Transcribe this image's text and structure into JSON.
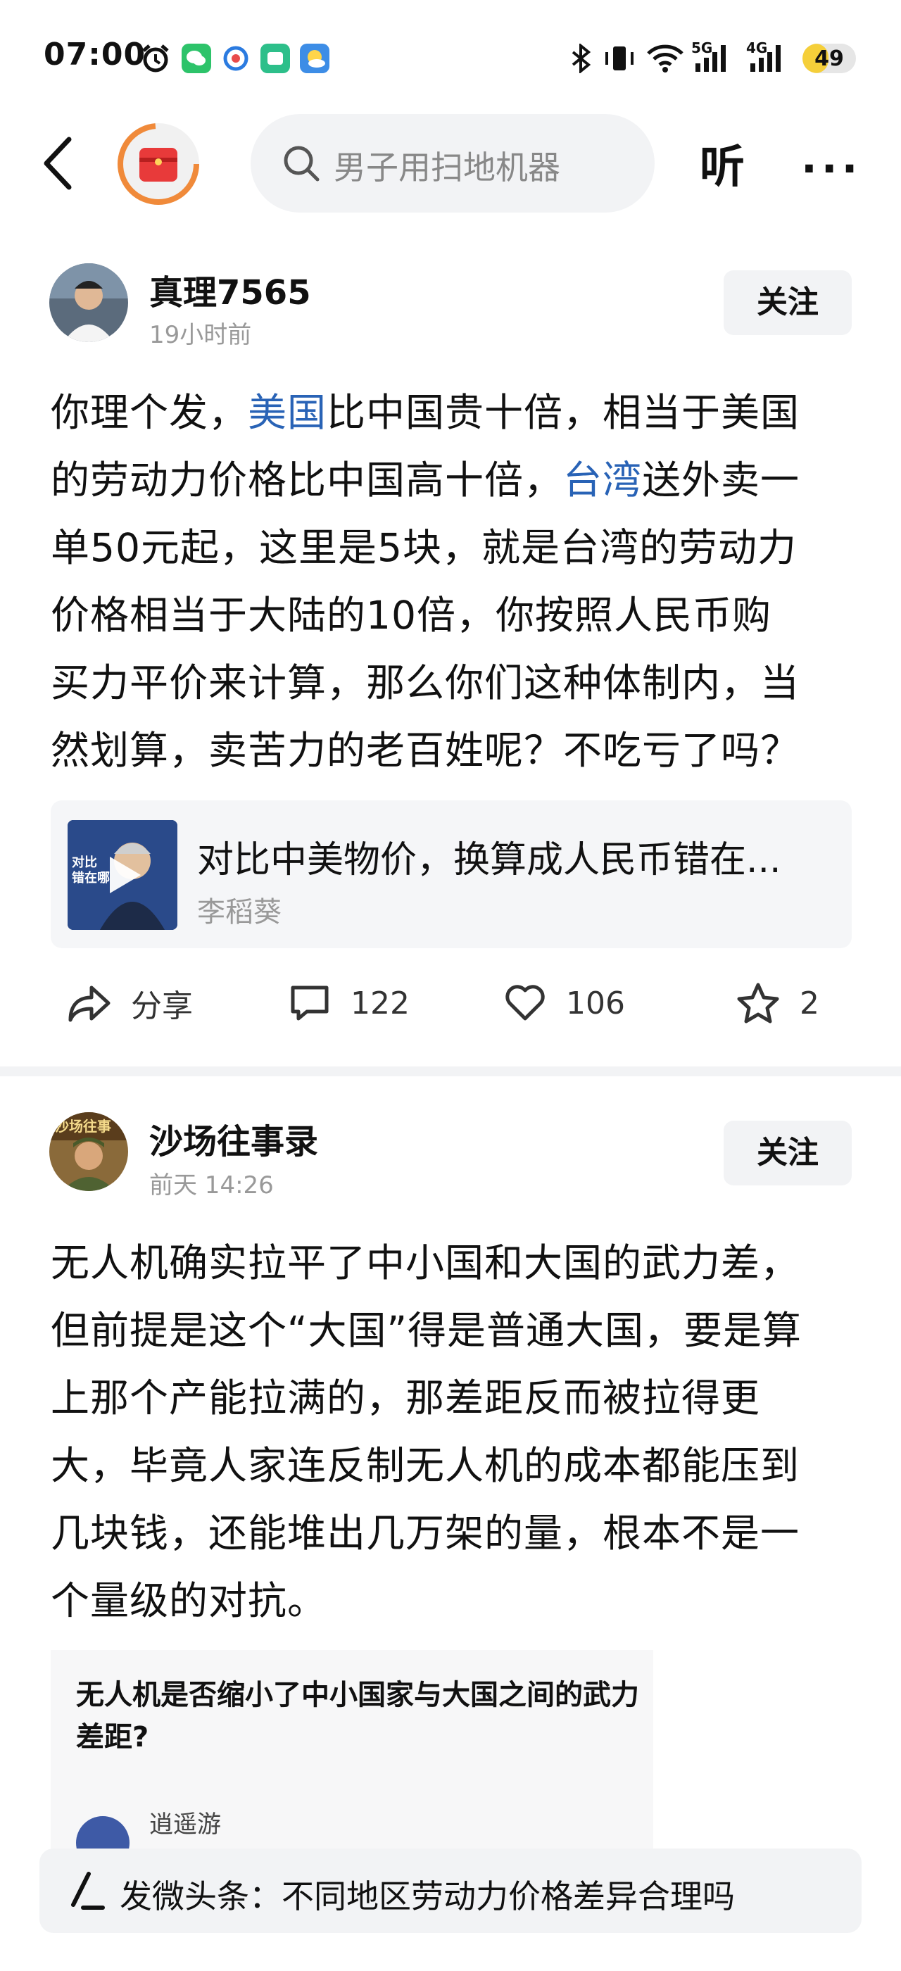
{
  "status_bar": {
    "time": "07:00",
    "battery": "49",
    "signal_labels": [
      "5G",
      "4G"
    ],
    "icons": [
      "alarm-icon",
      "wechat-icon",
      "app-icon",
      "app-icon",
      "weather-icon",
      "bluetooth-icon",
      "vibrate-icon",
      "wifi-icon",
      "signal-icon",
      "signal-icon"
    ]
  },
  "header": {
    "search_placeholder": "男子用扫地机器",
    "listen_label": "听",
    "more_label": "···"
  },
  "posts": [
    {
      "author": "真理7565",
      "time": "19小时前",
      "follow_label": "关注",
      "lines": [
        [
          "你理个发，",
          "美国",
          "比中国贵十倍，相当于美国"
        ],
        [
          "的劳动力价格比中国高十倍，",
          "台湾",
          "送外卖一"
        ],
        "单50元起，这里是5块，就是台湾的劳动力",
        "价格相当于大陆的10倍，你按照人民币购",
        "买力平价来计算，那么你们这种体制内，当",
        "然划算，卖苦力的老百姓呢？不吃亏了吗？"
      ],
      "card": {
        "title": "对比中美物价，换算成人民币错在...",
        "author": "李稻葵",
        "thumb_text": "对比\n错在哪"
      },
      "actions": {
        "share": "分享",
        "comments": "122",
        "likes": "106",
        "favorites": "2"
      }
    },
    {
      "author": "沙场往事录",
      "time": "前天  14:26",
      "follow_label": "关注",
      "avatar_text": "沙场往事",
      "lines": [
        "无人机确实拉平了中小国和大国的武力差，",
        "但前提是这个“大国”得是普通大国，要是算",
        "上那个产能拉满的，那差距反而被拉得更",
        "大，毕竟人家连反制无人机的成本都能压到",
        "几块钱，还能堆出几万架的量，根本不是一",
        "个量级的对抗。"
      ],
      "quote": {
        "title": "无人机是否缩小了中小国家与大国之间的武力差距?",
        "author": "逍遥游"
      }
    }
  ],
  "compose": {
    "text": "发微头条：不同地区劳动力价格差异合理吗"
  },
  "colors": {
    "link": "#2963b6",
    "battery_fill": "#f5cf3a",
    "logo_red": "#e83a3a",
    "logo_orange": "#f08a3a"
  }
}
